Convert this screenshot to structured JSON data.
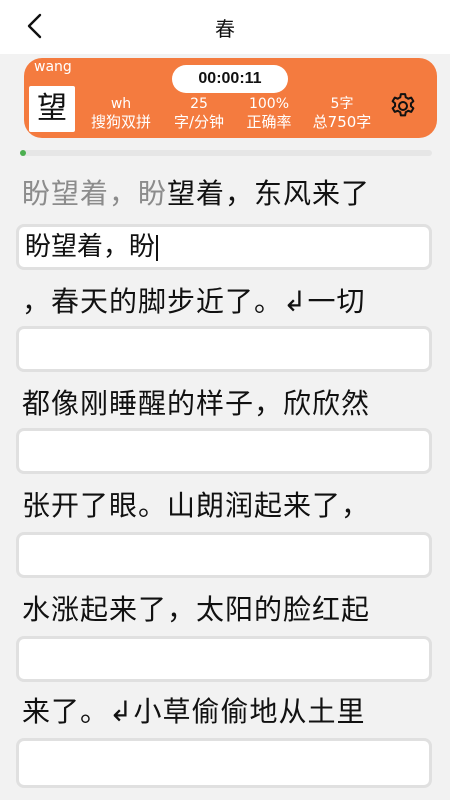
{
  "header": {
    "title": "春",
    "back_icon": "chevron-left-icon"
  },
  "stats": {
    "pinyin": "wang",
    "current_char": "望",
    "timer": "00:00:11",
    "scheme_code": "wh",
    "scheme_label": "搜狗双拼",
    "speed_value": "25",
    "speed_label": "字/分钟",
    "accuracy_value": "100%",
    "accuracy_label": "正确率",
    "count_value": "5字",
    "total_label": "总750字",
    "settings_icon": "gear-icon",
    "card_color": "#f47b3f"
  },
  "progress": {
    "fraction": 0.0067,
    "color": "#4caf50"
  },
  "lines": [
    {
      "source_done": "盼望着，盼",
      "source_rest": "望着，东风来了",
      "input": "盼望着，盼"
    },
    {
      "source_done": "",
      "source_rest": "，春天的脚步近了。↲一切",
      "input": ""
    },
    {
      "source_done": "",
      "source_rest": "都像刚睡醒的样子，欣欣然",
      "input": ""
    },
    {
      "source_done": "",
      "source_rest": "张开了眼。山朗润起来了，",
      "input": ""
    },
    {
      "source_done": "",
      "source_rest": "水涨起来了，太阳的脸红起",
      "input": ""
    },
    {
      "source_done": "",
      "source_rest": "来了。↲小草偷偷地从土里",
      "input": ""
    }
  ]
}
